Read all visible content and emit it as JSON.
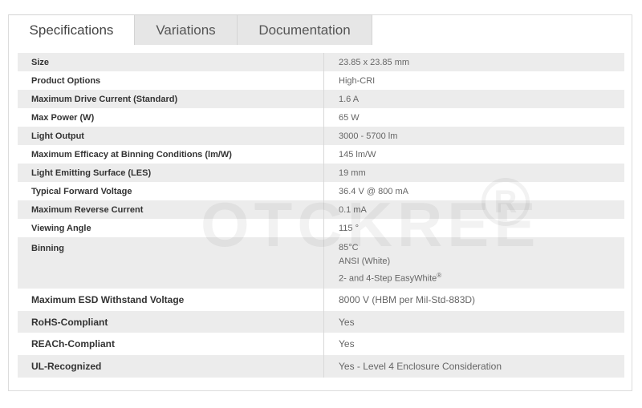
{
  "tabs": [
    {
      "label": "Specifications"
    },
    {
      "label": "Variations"
    },
    {
      "label": "Documentation"
    }
  ],
  "watermark": {
    "text": "OTCKREE",
    "mark": "R"
  },
  "specs": [
    {
      "label": "Size",
      "value": "23.85 x 23.85 mm"
    },
    {
      "label": "Product Options",
      "value": "High-CRI"
    },
    {
      "label": "Maximum Drive Current (Standard)",
      "value": "1.6 A"
    },
    {
      "label": "Max Power (W)",
      "value": "65 W"
    },
    {
      "label": "Light Output",
      "value": "3000 - 5700 lm"
    },
    {
      "label": "Maximum Efficacy at Binning Conditions (lm/W)",
      "value": "145 lm/W"
    },
    {
      "label": "Light Emitting Surface (LES)",
      "value": "19 mm"
    },
    {
      "label": "Typical Forward Voltage",
      "value": "36.4 V @ 800 mA"
    },
    {
      "label": "Maximum Reverse Current",
      "value": "0.1 mA"
    },
    {
      "label": "Viewing Angle",
      "value": "115 °"
    },
    {
      "label": "Binning",
      "values": [
        "85°C",
        "ANSI (White)",
        "2- and 4-Step EasyWhite"
      ],
      "superscript": "®"
    },
    {
      "label": "Maximum ESD Withstand Voltage",
      "value": "8000 V (HBM per Mil-Std-883D)"
    },
    {
      "label": "RoHS-Compliant",
      "value": "Yes"
    },
    {
      "label": "REACh-Compliant",
      "value": "Yes"
    },
    {
      "label": "UL-Recognized",
      "value": "Yes - Level 4 Enclosure Consideration"
    }
  ]
}
